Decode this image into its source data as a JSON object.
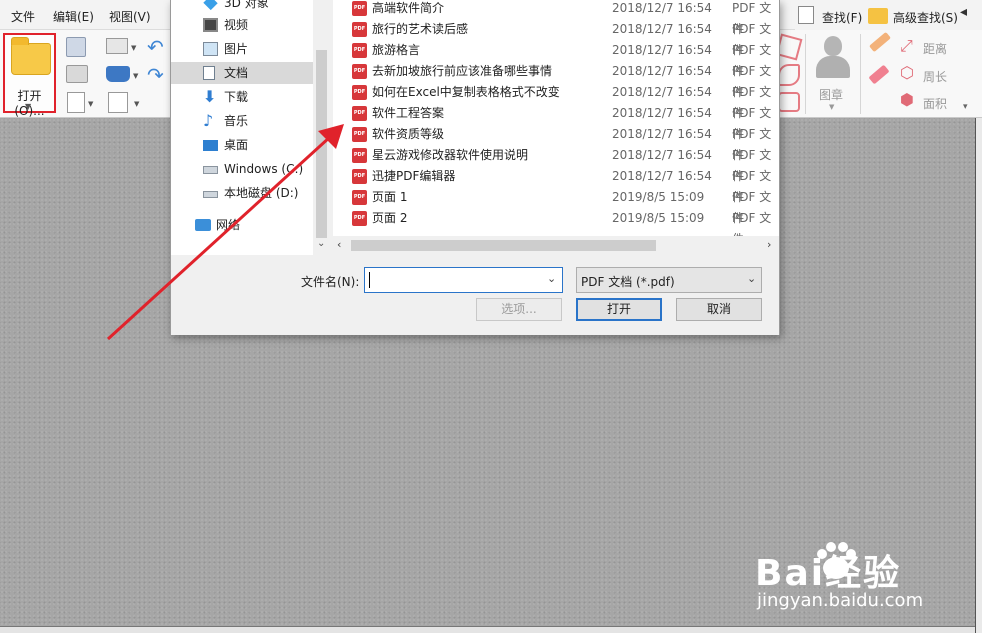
{
  "menubar": {
    "items": [
      "文件",
      "编辑(E)",
      "视图(V)"
    ],
    "find": "查找(F)",
    "advanced_find": "高级查找(S)"
  },
  "ribbon": {
    "open_label": "打开(O)...",
    "stamp_label": "图章",
    "distance_label": "距离",
    "perimeter_label": "周长",
    "area_label": "面积"
  },
  "dialog": {
    "nav_items": [
      "3D 对象",
      "视频",
      "图片",
      "文档",
      "下载",
      "音乐",
      "桌面",
      "Windows (C:)",
      "本地磁盘 (D:)",
      "网络"
    ],
    "selected_nav": "文档",
    "files": [
      {
        "name": "高端软件简介",
        "date": "2018/12/7 16:54",
        "type": "PDF 文件"
      },
      {
        "name": "旅行的艺术读后感",
        "date": "2018/12/7 16:54",
        "type": "PDF 文件"
      },
      {
        "name": "旅游格言",
        "date": "2018/12/7 16:54",
        "type": "PDF 文件"
      },
      {
        "name": "去新加坡旅行前应该准备哪些事情",
        "date": "2018/12/7 16:54",
        "type": "PDF 文件"
      },
      {
        "name": "如何在Excel中复制表格格式不改变",
        "date": "2018/12/7 16:54",
        "type": "PDF 文件"
      },
      {
        "name": "软件工程答案",
        "date": "2018/12/7 16:54",
        "type": "PDF 文件"
      },
      {
        "name": "软件资质等级",
        "date": "2018/12/7 16:54",
        "type": "PDF 文件"
      },
      {
        "name": "星云游戏修改器软件使用说明",
        "date": "2018/12/7 16:54",
        "type": "PDF 文件"
      },
      {
        "name": "迅捷PDF编辑器",
        "date": "2018/12/7 16:54",
        "type": "PDF 文件"
      },
      {
        "name": "页面 1",
        "date": "2019/8/5 15:09",
        "type": "PDF 文件"
      },
      {
        "name": "页面 2",
        "date": "2019/8/5 15:09",
        "type": "PDF 文件"
      }
    ],
    "pdf_icon_text": "PDF",
    "filename_label": "文件名(N):",
    "filename_value": "",
    "filetype_value": "PDF 文档 (*.pdf)",
    "options_button": "选项...",
    "open_button": "打开",
    "cancel_button": "取消"
  },
  "watermark": {
    "brand": "Bai经验",
    "url": "jingyan.baidu.com"
  },
  "colors": {
    "highlight_border": "#e0222b",
    "annotation_arrow": "#e0222b",
    "pdf_icon": "#d7373a",
    "workspace": "#a6a6a6"
  }
}
